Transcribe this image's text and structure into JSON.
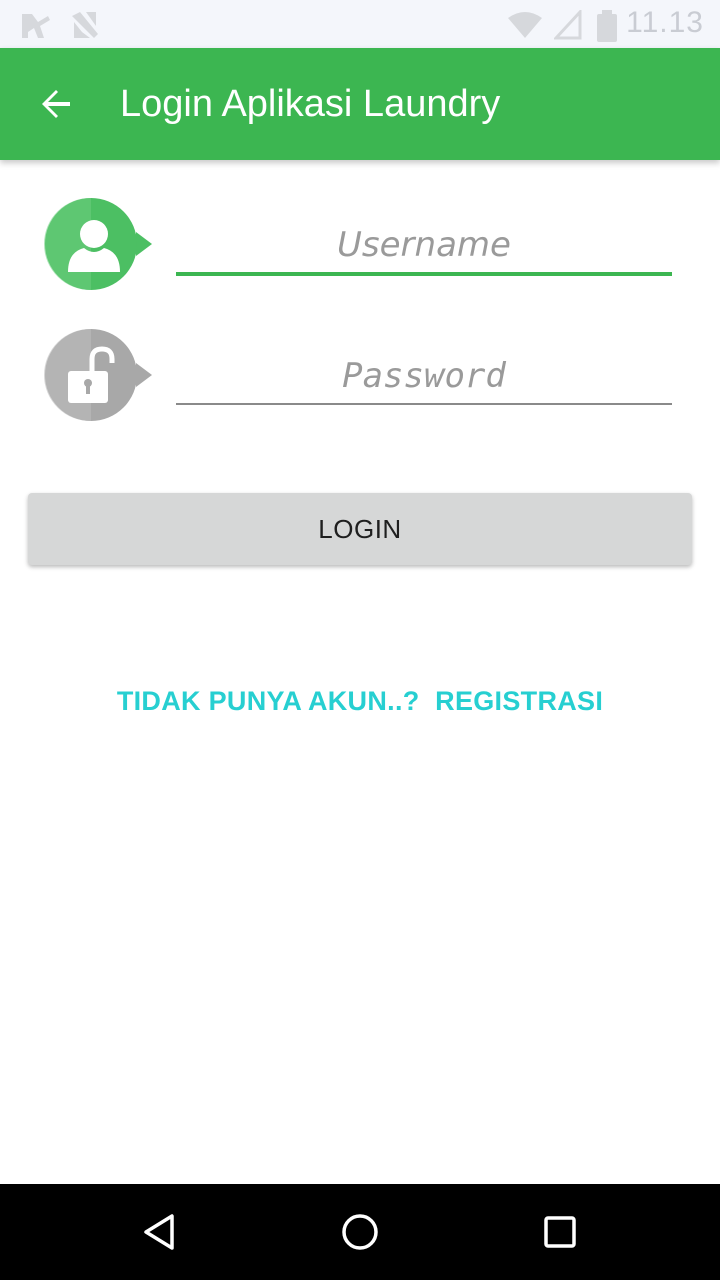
{
  "status_bar": {
    "time": "11.13",
    "icons": [
      "notification-icon",
      "no-sim-icon",
      "wifi-icon",
      "signal-icon",
      "battery-icon"
    ]
  },
  "app_bar": {
    "title": "Login Aplikasi Laundry",
    "back_icon": "arrow-left-icon",
    "color": "#3cb651"
  },
  "form": {
    "username": {
      "placeholder": "Username",
      "value": "",
      "icon": "user-icon",
      "icon_color": "#4cbf63"
    },
    "password": {
      "placeholder": "Password",
      "value": "",
      "icon": "unlocked-padlock-icon",
      "icon_color": "#a8a8a8"
    },
    "login_button": "LOGIN"
  },
  "register_link": "TIDAK PUNYA AKUN..?  REGISTRASI",
  "register_color": "#27cfd1",
  "nav_bar": {
    "buttons": [
      "back-triangle-icon",
      "home-circle-icon",
      "recent-apps-square-icon"
    ]
  }
}
